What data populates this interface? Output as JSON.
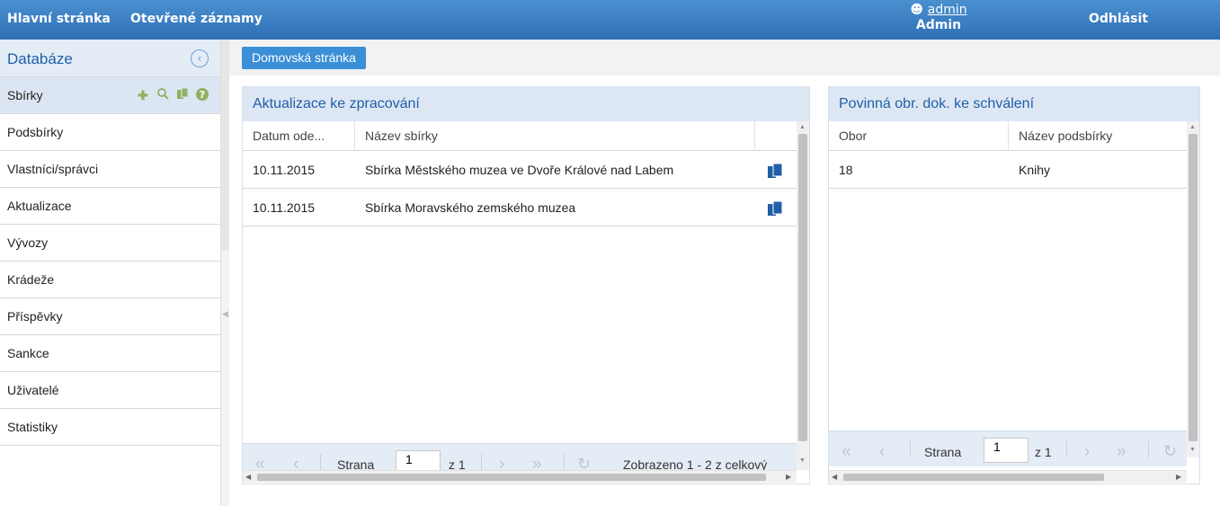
{
  "topbar": {
    "home_label": "Hlavní stránka",
    "open_records_label": "Otevřené záznamy",
    "username": "admin",
    "role": "Admin",
    "logout_label": "Odhlásit"
  },
  "sidebar": {
    "title": "Databáze",
    "items": [
      {
        "label": "Sbírky"
      },
      {
        "label": "Podsbírky"
      },
      {
        "label": "Vlastníci/správci"
      },
      {
        "label": "Aktualizace"
      },
      {
        "label": "Vývozy"
      },
      {
        "label": "Krádeže"
      },
      {
        "label": "Příspěvky"
      },
      {
        "label": "Sankce"
      },
      {
        "label": "Uživatelé"
      },
      {
        "label": "Statistiky"
      }
    ],
    "tool_icons": [
      "plus-icon",
      "search-icon",
      "copy-icon",
      "help-icon"
    ]
  },
  "tabs": {
    "home_tab": "Domovská stránka"
  },
  "updates_panel": {
    "title": "Aktualizace ke zpracování",
    "columns": [
      "Datum ode...",
      "Název sbírky"
    ],
    "rows": [
      {
        "date": "10.11.2015",
        "name": "Sbírka Městského muzea ve Dvoře Králové nad Labem"
      },
      {
        "date": "10.11.2015",
        "name": "Sbírka Moravského zemského muzea"
      }
    ],
    "pager": {
      "page_label": "Strana",
      "page_value": "1",
      "of_label": "z 1",
      "summary": "Zobrazeno 1 - 2 z celkový"
    }
  },
  "approval_panel": {
    "title": "Povinná obr. dok. ke schválení",
    "columns": [
      "Obor",
      "Název podsbírky"
    ],
    "rows": [
      {
        "field": "18",
        "name": "Knihy"
      }
    ],
    "pager": {
      "page_label": "Strana",
      "page_value": "1",
      "of_label": "z 1"
    }
  },
  "colors": {
    "topbar": "#2f6fb5",
    "accent": "#3a8fd6",
    "panel_header": "#dde7f4",
    "icon_blue": "#1f5fa8",
    "tool_green": "#8fb063"
  }
}
